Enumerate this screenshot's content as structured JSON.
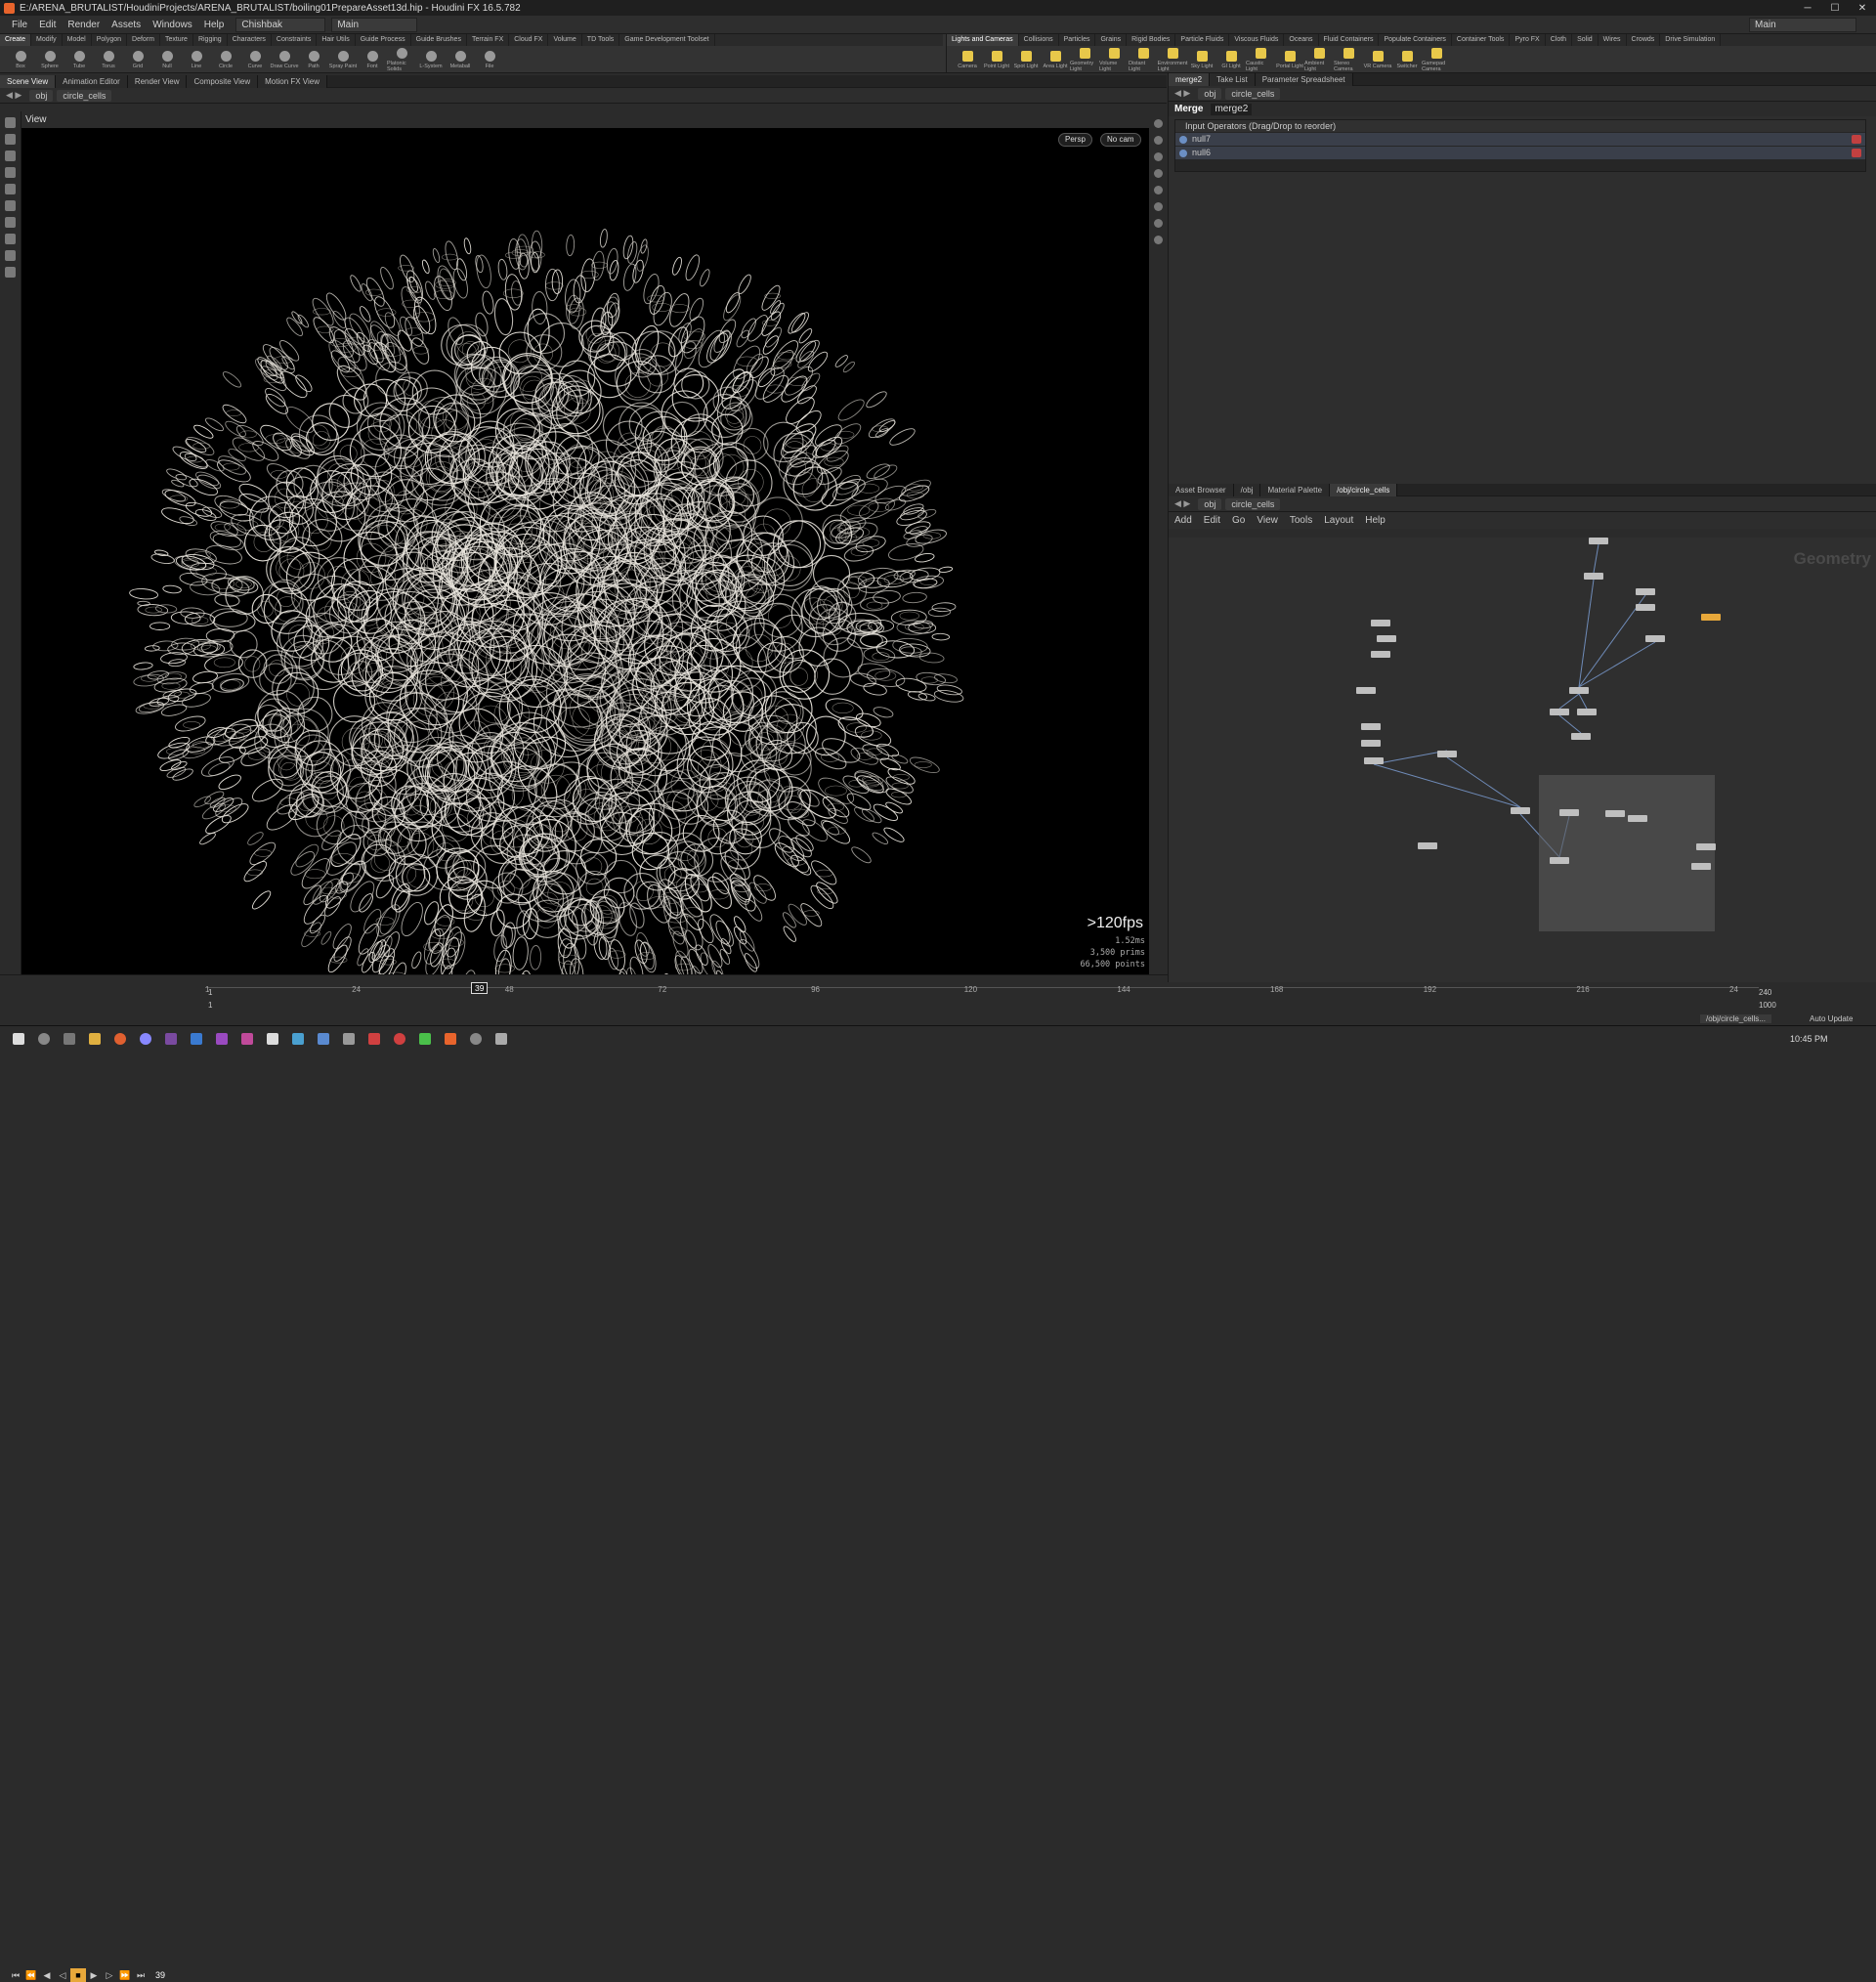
{
  "window": {
    "title": "E:/ARENA_BRUTALIST/HoudiniProjects/ARENA_BRUTALIST/boiling01PrepareAsset13d.hip - Houdini FX 16.5.782"
  },
  "menu": [
    "File",
    "Edit",
    "Render",
    "Assets",
    "Windows",
    "Help"
  ],
  "desktop_combo": "Chishbak",
  "main_combo": "Main",
  "main_combo_right": "Main",
  "shelf_left": {
    "tabs": [
      "Create",
      "Modify",
      "Model",
      "Polygon",
      "Deform",
      "Texture",
      "Rigging",
      "Characters",
      "Constraints",
      "Hair Utils",
      "Guide Process",
      "Guide Brushes",
      "Terrain FX",
      "Cloud FX",
      "Volume",
      "TD Tools",
      "Game Development Toolset"
    ],
    "tools": [
      "Box",
      "Sphere",
      "Tube",
      "Torus",
      "Grid",
      "Null",
      "Line",
      "Circle",
      "Curve",
      "Draw Curve",
      "Path",
      "Spray Paint",
      "Font",
      "Platonic Solids",
      "L-System",
      "Metaball",
      "File"
    ]
  },
  "shelf_right": {
    "tabs": [
      "Lights and Cameras",
      "Collisions",
      "Particles",
      "Grains",
      "Rigid Bodies",
      "Particle Fluids",
      "Viscous Fluids",
      "Oceans",
      "Fluid Containers",
      "Populate Containers",
      "Container Tools",
      "Pyro FX",
      "Cloth",
      "Solid",
      "Wires",
      "Crowds",
      "Drive Simulation"
    ],
    "tools": [
      "Camera",
      "Point Light",
      "Spot Light",
      "Area Light",
      "Geometry Light",
      "Volume Light",
      "Distant Light",
      "Environment Light",
      "Sky Light",
      "GI Light",
      "Caustic Light",
      "Portal Light",
      "Ambient Light",
      "Stereo Camera",
      "VR Camera",
      "Switcher",
      "Gamepad Camera"
    ]
  },
  "scene_tabs": [
    "Scene View",
    "Animation Editor",
    "Render View",
    "Composite View",
    "Motion FX View"
  ],
  "scene_path": {
    "root": "obj",
    "node": "circle_cells"
  },
  "viewport": {
    "title": "View",
    "persp": "Persp",
    "cam": "No cam",
    "fps": ">120fps",
    "time": "1.52ms",
    "prims": "3,500  prims",
    "points": "66,500 points"
  },
  "timeline": {
    "current_frame": "39",
    "start": "1",
    "start2": "1",
    "end": "240",
    "end2": "1000",
    "ticks": [
      "1",
      "24",
      "48",
      "72",
      "96",
      "120",
      "144",
      "168",
      "192",
      "216",
      "24"
    ],
    "marker": "39"
  },
  "param_tabs": [
    "merge2",
    "Take List",
    "Parameter Spreadsheet"
  ],
  "param_path": {
    "root": "obj",
    "node": "circle_cells"
  },
  "merge": {
    "type": "Merge",
    "name": "merge2",
    "list_header": "Input Operators (Drag/Drop to reorder)",
    "inputs": [
      "null7",
      "null6"
    ]
  },
  "net_tabs": [
    "Asset Browser",
    "/obj",
    "Material Palette",
    "/obj/circle_cells"
  ],
  "net_path": {
    "root": "obj",
    "node": "circle_cells"
  },
  "net_menu": [
    "Add",
    "Edit",
    "Go",
    "View",
    "Tools",
    "Layout",
    "Help"
  ],
  "net_context": "Geometry",
  "status": {
    "path": "/obj/circle_cells...",
    "update": "Auto Update"
  },
  "clock": "10:45 PM"
}
